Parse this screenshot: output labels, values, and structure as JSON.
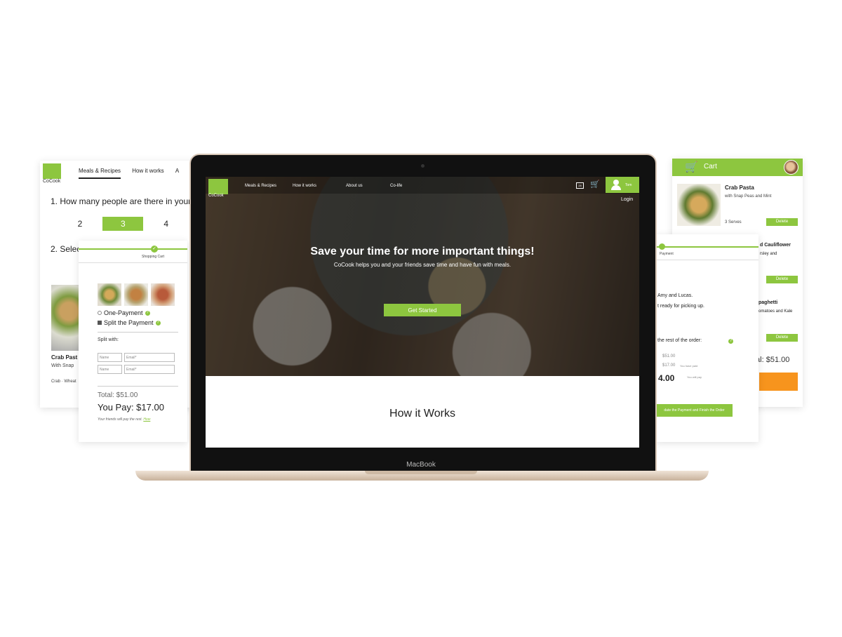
{
  "left_back": {
    "logo_text": "CoCook",
    "nav": [
      "Meals & Recipes",
      "How it works",
      "A"
    ],
    "question1": "1. How many people are there in your",
    "counts": [
      "2",
      "3",
      "4"
    ],
    "question2": "2. Selec",
    "meal_name": "Crab Past",
    "meal_sub": "With Snap",
    "meal_tags": "Crab · Wheat"
  },
  "left_front": {
    "step_label": "Shopping Cart",
    "step_check": "✓",
    "option_one": "One-Payment",
    "option_split": "Split the Payment",
    "help": "?",
    "split_with": "Split with:",
    "name_placeholder": "Name",
    "email_placeholder": "Email*",
    "total": "Total: $51.00",
    "you_pay": "You Pay: $17.00",
    "note": "Your friends will pay the rest.",
    "note_link": "How"
  },
  "right_back": {
    "cart_title": "Cart",
    "cart_icon": "🛒",
    "item1_name": "Crab Pasta",
    "item1_sub": "with Snap Peas and Mint",
    "item1_serves": "3 Serves",
    "delete_label": "Delete",
    "item2_frag": "d Cauliflower",
    "item2_sub_frag": "rsley and",
    "item3_frag": "paghetti",
    "item3_sub_frag": "omatoes and Kale",
    "total_frag": "tal: $51.00"
  },
  "right_front": {
    "step_label": "Payment",
    "line1": "Amy and Lucas.",
    "line2": "t ready for picking up.",
    "line3": "the rest of the order:",
    "help": "?",
    "amt1": "$51.00",
    "amt2": "$17.00",
    "amt2_note": "You have paid",
    "amt3_note": "You will pay",
    "amt_big": "4.00",
    "cta": "date the Payment and Finish the Order"
  },
  "laptop": {
    "brand": "MacBook"
  },
  "screen": {
    "logo_text": "CoCook",
    "nav_links": [
      "Meals & Recipes",
      "How it works",
      "About us",
      "Co-life"
    ],
    "calendar_label": "28",
    "cart_icon": "🛒",
    "user_name": "Tom",
    "login": "Login",
    "hero_title": "Save your time for more important things!",
    "hero_sub": "CoCook helps you and your friends save time and have fun with meals.",
    "cta": "Get Started",
    "section_title": "How it Works"
  },
  "colors": {
    "brand_green": "#8dc63f",
    "accent_orange": "#f7941d",
    "laptop_gold": "#e8d8c6"
  }
}
